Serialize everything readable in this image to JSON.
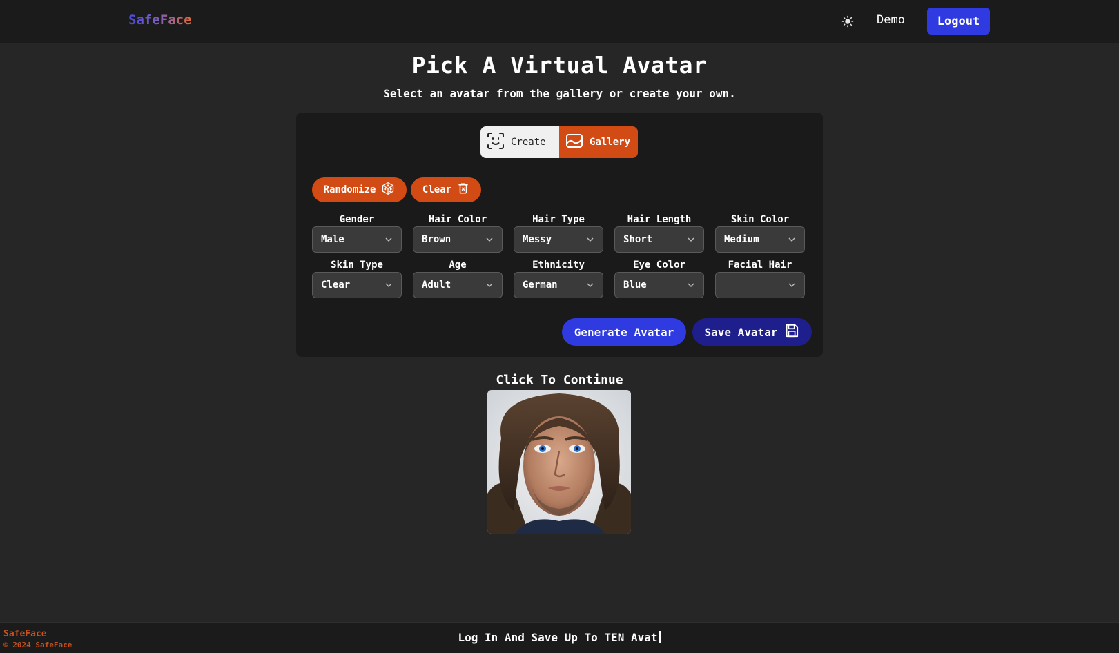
{
  "header": {
    "brand": "SafeFace",
    "theme_icon": "sun-icon",
    "demo_label": "Demo",
    "logout_label": "Logout"
  },
  "main": {
    "title": "Pick A Virtual Avatar",
    "subtitle": "Select an avatar from the gallery or create your own."
  },
  "tabs": {
    "create_label": "Create",
    "gallery_label": "Gallery",
    "active": "Gallery"
  },
  "actions": {
    "randomize_label": "Randomize",
    "clear_label": "Clear",
    "generate_label": "Generate Avatar",
    "save_label": "Save Avatar"
  },
  "fields": [
    {
      "label": "Gender",
      "value": "Male"
    },
    {
      "label": "Hair Color",
      "value": "Brown"
    },
    {
      "label": "Hair Type",
      "value": "Messy"
    },
    {
      "label": "Hair Length",
      "value": "Short"
    },
    {
      "label": "Skin Color",
      "value": "Medium"
    },
    {
      "label": "Skin Type",
      "value": "Clear"
    },
    {
      "label": "Age",
      "value": "Adult"
    },
    {
      "label": "Ethnicity",
      "value": "German"
    },
    {
      "label": "Eye Color",
      "value": "Blue"
    },
    {
      "label": "Facial Hair",
      "value": ""
    }
  ],
  "result": {
    "continue_label": "Click To Continue"
  },
  "footer": {
    "brand": "SafeFace",
    "copyright": "© 2024 SafeFace",
    "marquee": "Log In And Save Up To TEN Avat"
  },
  "colors": {
    "accent_orange": "#d24b14",
    "accent_blue": "#2f3be0",
    "accent_navy": "#1e1f8c",
    "background": "#262626"
  }
}
